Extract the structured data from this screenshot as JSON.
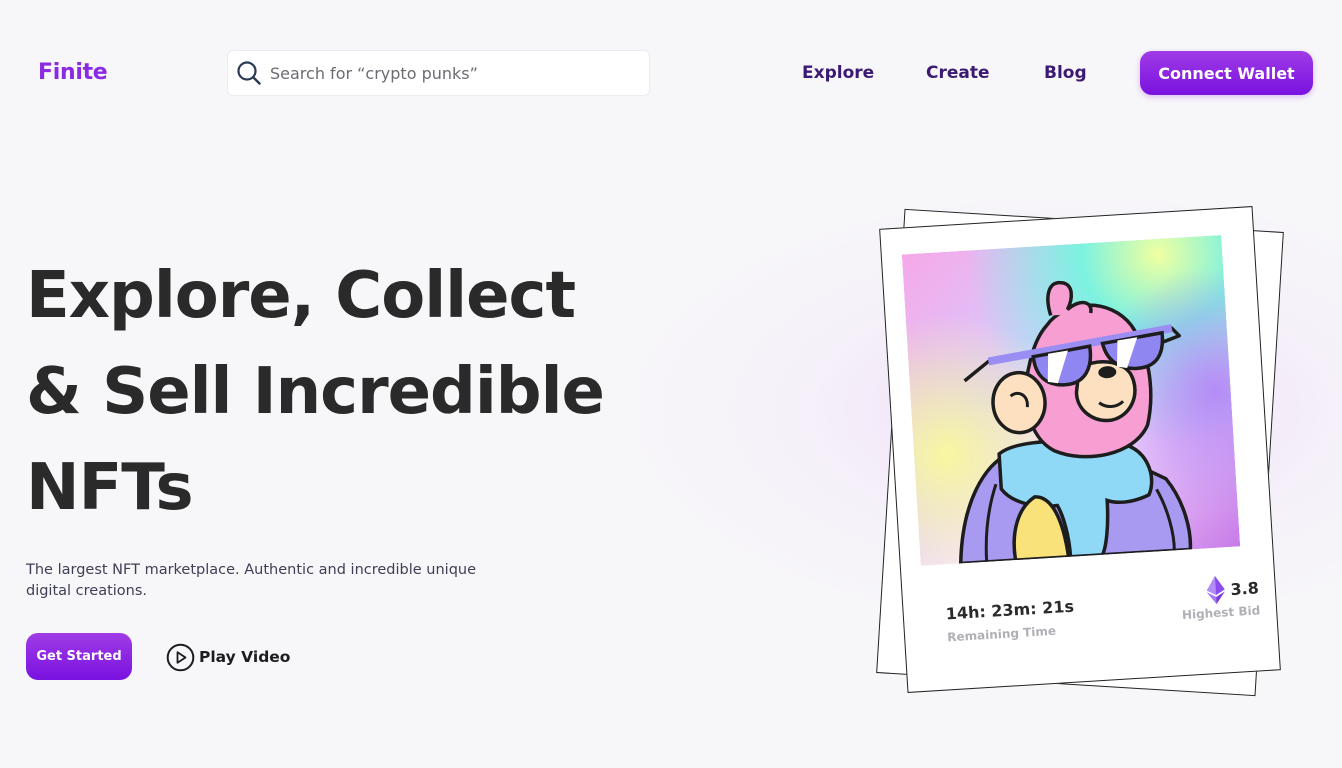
{
  "header": {
    "logo": "Finite",
    "search_placeholder": "Search for “crypto punks”",
    "nav": [
      "Explore",
      "Create",
      "Blog"
    ],
    "connect_label": "Connect Wallet"
  },
  "hero": {
    "title_lines": [
      "Explore, Collect",
      "& Sell Incredible",
      "NFTs"
    ],
    "subtitle": "The largest NFT marketplace. Authentic and incredible unique digital creations.",
    "get_started_label": "Get Started",
    "play_video_label": "Play Video"
  },
  "nft_card": {
    "remaining_time": "14h: 23m: 21s",
    "remaining_time_label": "Remaining Time",
    "highest_bid": "3.8",
    "highest_bid_label": "Highest Bid",
    "currency_icon": "ethereum-icon"
  },
  "colors": {
    "brand": "#8a2be2",
    "button_gradient_start": "#a03be6",
    "button_gradient_end": "#7a12e0",
    "nav_text": "#3b1a73",
    "heading": "#2a2a2a"
  }
}
